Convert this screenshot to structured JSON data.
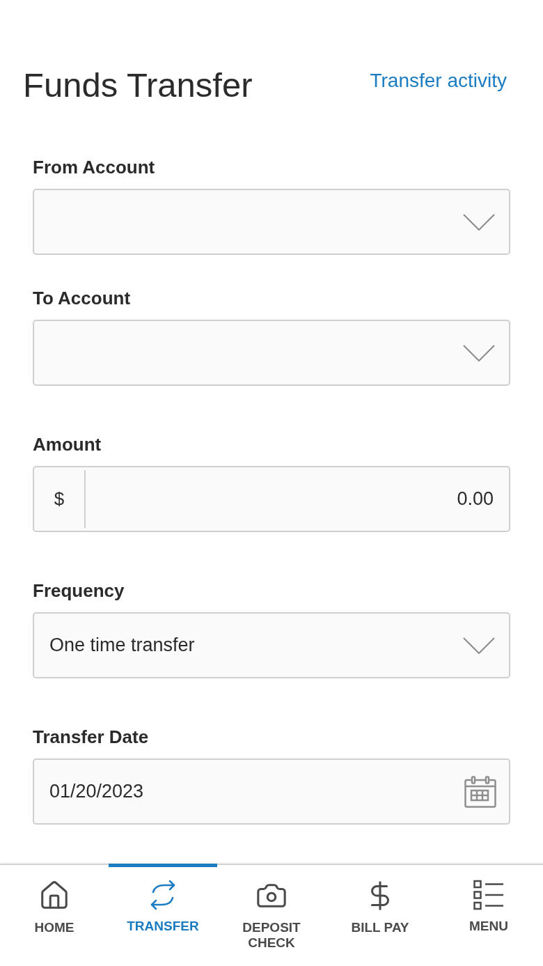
{
  "header": {
    "title": "Funds Transfer",
    "link": "Transfer activity"
  },
  "fields": [
    {
      "kind": "select",
      "label": "From Account"
    },
    {
      "kind": "select",
      "label": "To Account"
    },
    {
      "kind": "currency",
      "label": "Amount",
      "prefix": "$",
      "value": "0.00"
    },
    {
      "kind": "select",
      "label": "Frequency",
      "value": "One time transfer"
    },
    {
      "kind": "date",
      "label": "Transfer Date",
      "value": "01/20/2023"
    }
  ],
  "bottom_nav": [
    {
      "label": "HOME",
      "selected": false
    },
    {
      "label": "TRANSFER",
      "selected": true
    },
    {
      "label": "DEPOSIT CHECK",
      "selected": false
    },
    {
      "label": "BILL PAY",
      "selected": false
    },
    {
      "label": "MENU",
      "selected": false
    }
  ]
}
